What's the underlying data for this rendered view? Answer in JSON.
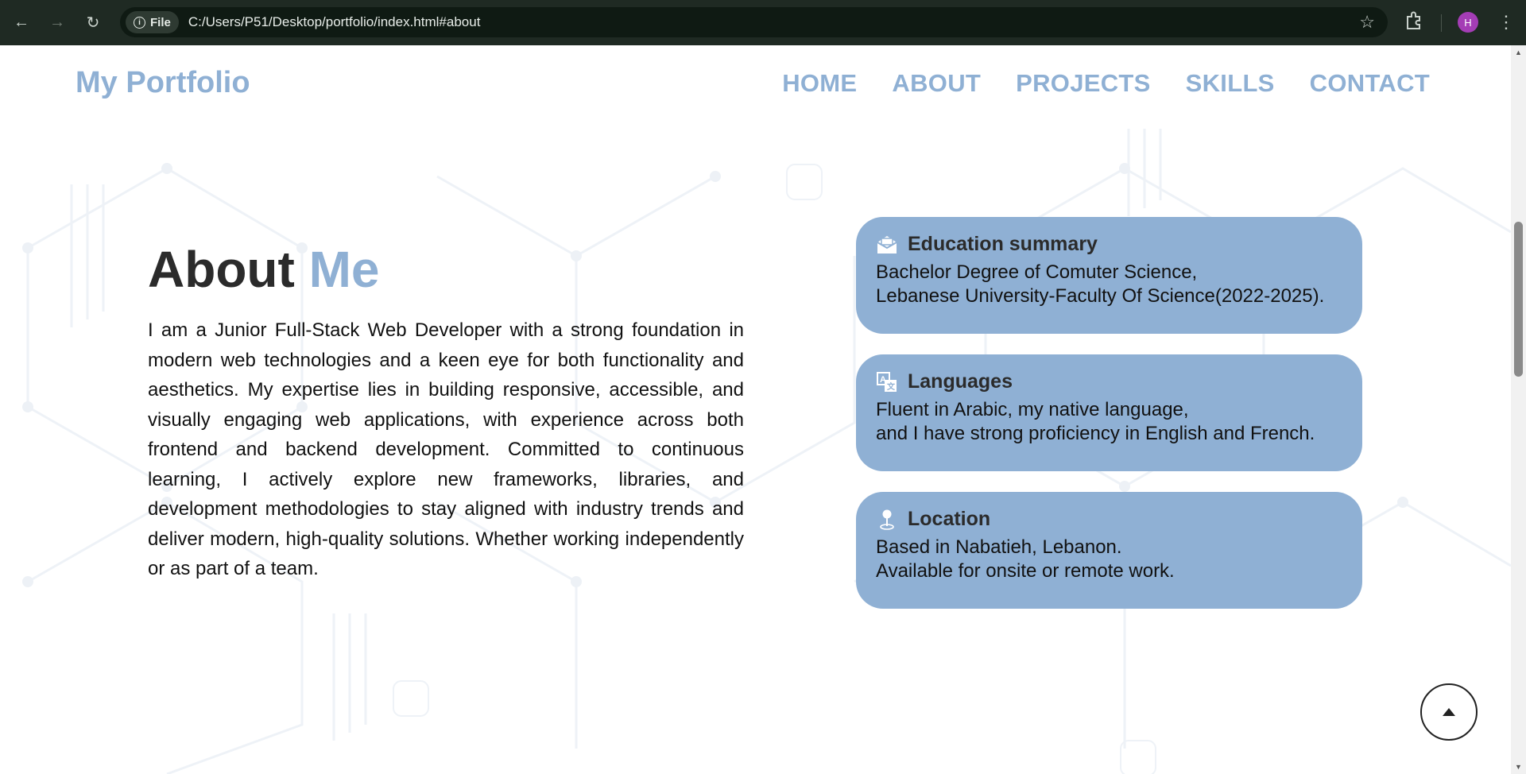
{
  "browser": {
    "file_chip": "File",
    "url": "C:/Users/P51/Desktop/portfolio/index.html#about",
    "profile_initial": "H"
  },
  "site": {
    "logo": "My Portfolio",
    "nav": [
      "HOME",
      "ABOUT",
      "PROJECTS",
      "SKILLS",
      "CONTACT"
    ]
  },
  "about": {
    "title_main": "About",
    "title_accent": "Me",
    "body": "I am a Junior Full-Stack Web Developer with a strong foundation in modern web technologies and a keen eye for both functionality and aesthetics. My expertise lies in building responsive, accessible, and visually engaging web applications, with experience across both frontend and backend development. Committed to continuous learning, I actively explore new frameworks, libraries, and development methodologies to stay aligned with industry trends and deliver modern, high-quality solutions. Whether working independently or as part of a team."
  },
  "cards": [
    {
      "icon": "envelope-icon",
      "title": "Education summary",
      "lines": [
        "Bachelor Degree of Comuter Science,",
        "Lebanese University-Faculty Of Science(2022-2025)."
      ]
    },
    {
      "icon": "translate-icon",
      "title": "Languages",
      "lines": [
        "Fluent in Arabic, my native language,",
        "and I have strong proficiency in English and French."
      ]
    },
    {
      "icon": "map-pin-icon",
      "title": "Location",
      "lines": [
        "Based in Nabatieh, Lebanon.",
        "Available for onsite or remote work."
      ]
    }
  ],
  "colors": {
    "accent": "#8fb0d4",
    "chrome": "#1f2a23",
    "heading": "#2b2b2b"
  }
}
